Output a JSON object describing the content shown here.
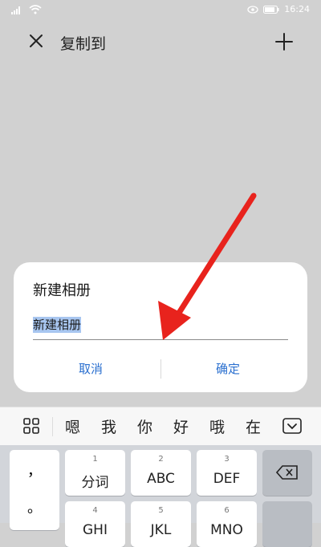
{
  "status": {
    "time": "16:24"
  },
  "header": {
    "title": "复制到"
  },
  "dialog": {
    "title": "新建相册",
    "input_value": "新建相册",
    "cancel_label": "取消",
    "ok_label": "确定"
  },
  "candidates": [
    "嗯",
    "我",
    "你",
    "好",
    "哦",
    "在"
  ],
  "keyboard": {
    "punct_top": "，",
    "punct_bottom": "。",
    "keys": [
      {
        "num": "1",
        "label": "分词"
      },
      {
        "num": "2",
        "label": "ABC"
      },
      {
        "num": "3",
        "label": "DEF"
      },
      {
        "num": "4",
        "label": "GHI"
      },
      {
        "num": "5",
        "label": "JKL"
      },
      {
        "num": "6",
        "label": "MNO"
      }
    ]
  },
  "colors": {
    "accent": "#2a6fcf",
    "arrow": "#e8231d",
    "selection": "#a8c6f0"
  },
  "icons": [
    "close-icon",
    "plus-icon",
    "grid-icon",
    "keyboard-hide-icon",
    "backspace-icon",
    "wifi-icon",
    "signal-icon",
    "battery-icon",
    "eye-icon"
  ]
}
